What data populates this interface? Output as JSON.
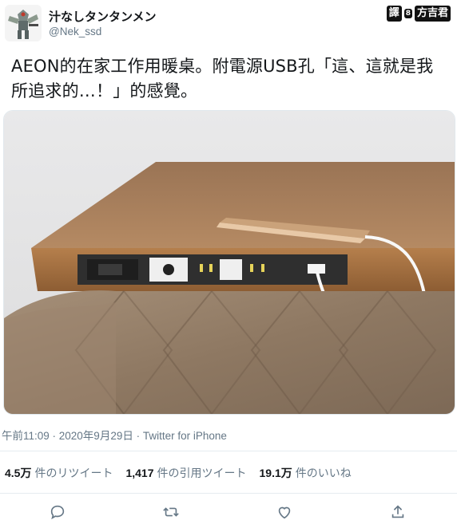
{
  "user": {
    "display_name": "汁なしタンタンメン",
    "handle": "@Nek_ssd",
    "avatar_icon": "robot-mecha-avatar"
  },
  "watermark": {
    "prefix": "譯",
    "dot": "8",
    "translator": "方吉君"
  },
  "tweet": {
    "text": "AEON的在家工作用暖桌。附電源USB孔「這、這就是我所追求的…！」的感覺。"
  },
  "photo": {
    "description_icon": "kotatsu-table-photo"
  },
  "meta": {
    "timestamp": "午前11:09 · 2020年9月29日 · Twitter for iPhone"
  },
  "stats": {
    "retweets_count": "4.5万",
    "retweets_label": "件のリツイート",
    "quotes_count": "1,417",
    "quotes_label": "件の引用ツイート",
    "likes_count": "19.1万",
    "likes_label": "件のいいね"
  },
  "colors": {
    "text": "#14171a",
    "secondary": "#657786",
    "divider": "#e6ecf0"
  }
}
